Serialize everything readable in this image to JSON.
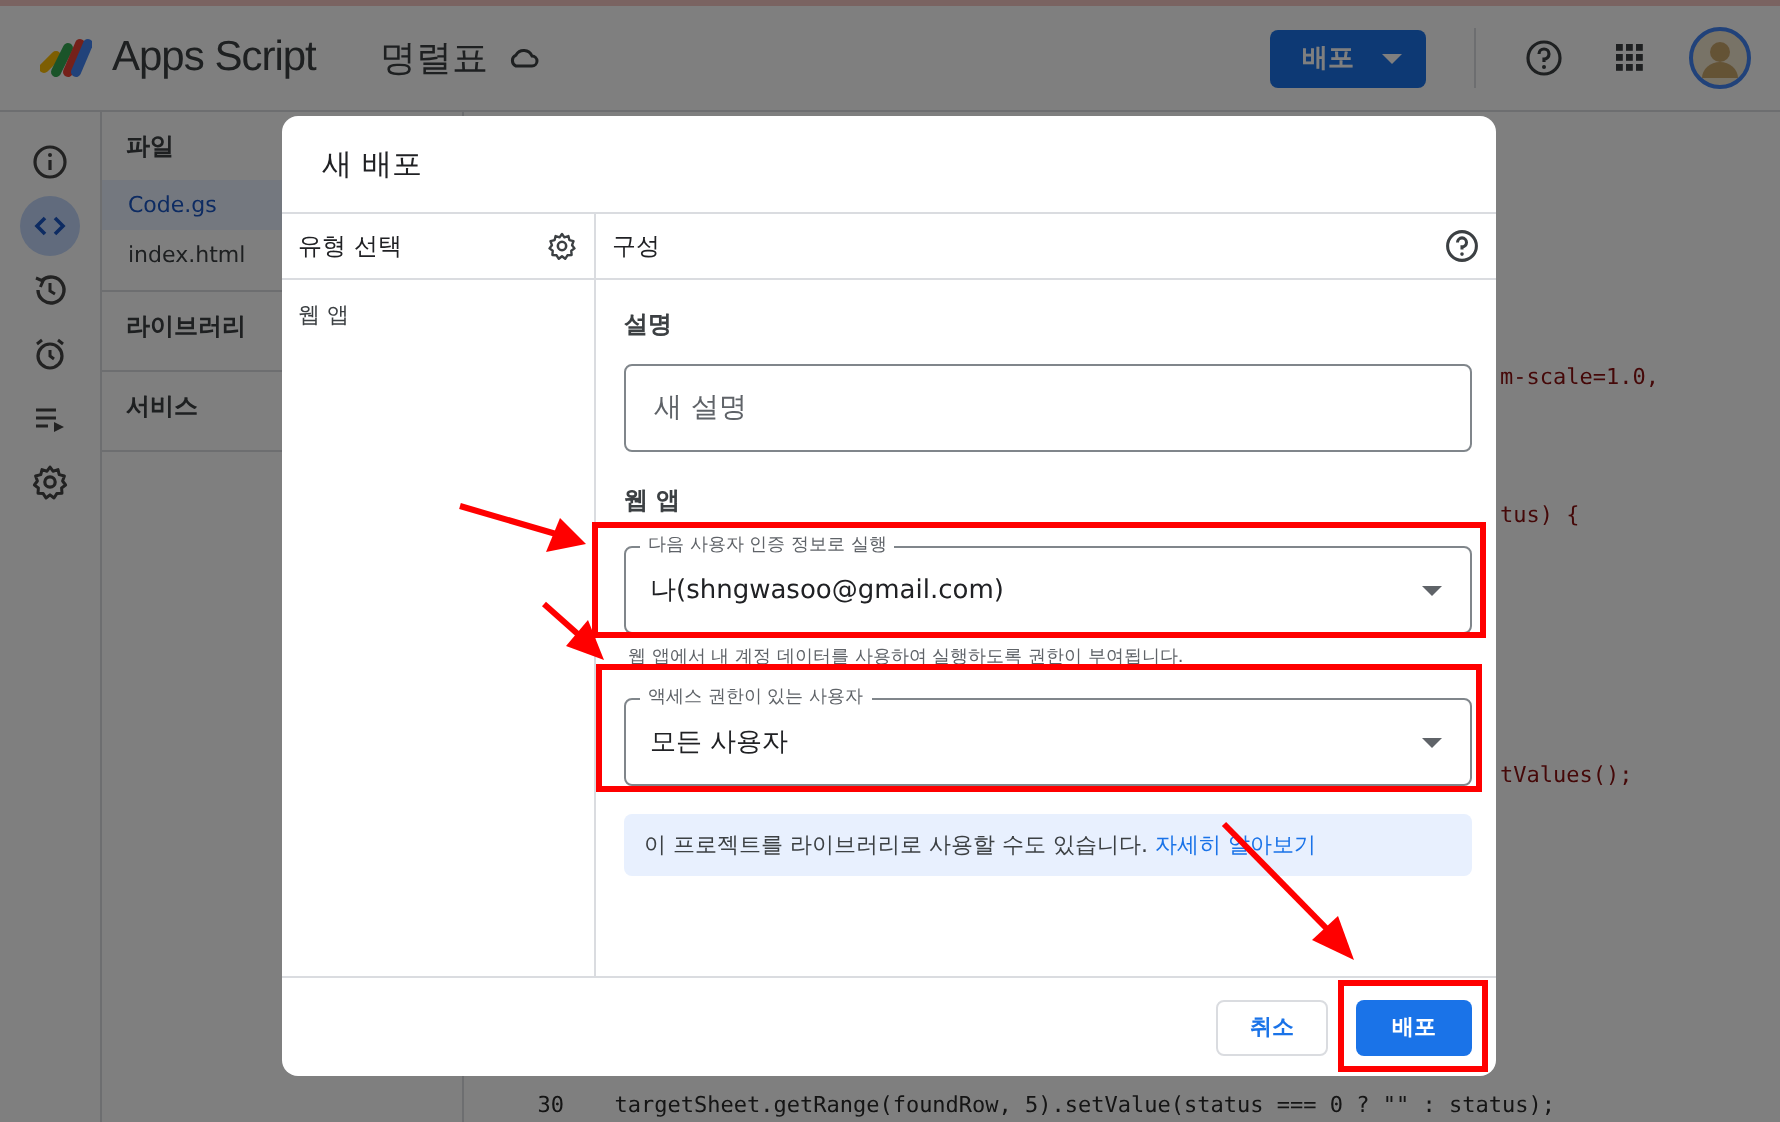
{
  "app_bar": {
    "product": "Apps Script",
    "project": "명렬표",
    "deploy_button": "배포"
  },
  "rail": [
    {
      "kind": "info",
      "selected": false
    },
    {
      "kind": "code",
      "selected": true
    },
    {
      "kind": "history",
      "selected": false
    },
    {
      "kind": "alarm",
      "selected": false
    },
    {
      "kind": "executions",
      "selected": false
    },
    {
      "kind": "settings",
      "selected": false
    }
  ],
  "files_panel": {
    "sections": [
      {
        "title": "파일",
        "items": [
          {
            "label": "Code.gs",
            "selected": true
          },
          {
            "label": "index.html",
            "selected": false
          }
        ]
      },
      {
        "title": "라이브러리"
      },
      {
        "title": "서비스"
      }
    ]
  },
  "editor": {
    "lines": [
      {
        "kind": "fragment",
        "text": "m-scale=1.0,"
      },
      {
        "kind": "fragment",
        "text": "tus) {"
      },
      {
        "kind": "fragment",
        "text": "tValues();"
      },
      {
        "kind": "full",
        "number": "30",
        "text": "  targetSheet.getRange(foundRow, 5).setValue(status === 0 ? \"\" : status);"
      }
    ]
  },
  "dialog": {
    "title": "새 배포",
    "type_header": "유형 선택",
    "config_header": "구성",
    "types": [
      {
        "label": "웹 앱"
      }
    ],
    "description_label": "설명",
    "description_field": {
      "placeholder": "새 설명"
    },
    "web_app_label": "웹 앱",
    "execute_as": {
      "label": "다음 사용자 인증 정보로 실행",
      "value": "나(shngwasoo@gmail.com)"
    },
    "execute_as_hint": "웹 앱에서 내 계정 데이터를 사용하여 실행하도록 권한이 부여됩니다.",
    "access": {
      "label": "액세스 권한이 있는 사용자",
      "value": "모든 사용자"
    },
    "info": {
      "text": "이 프로젝트를 라이브러리로 사용할 수도 있습니다.",
      "link": "자세히 알아보기"
    },
    "buttons": [
      {
        "kind": "secondary",
        "label": "취소"
      },
      {
        "kind": "primary",
        "label": "배포"
      }
    ]
  }
}
